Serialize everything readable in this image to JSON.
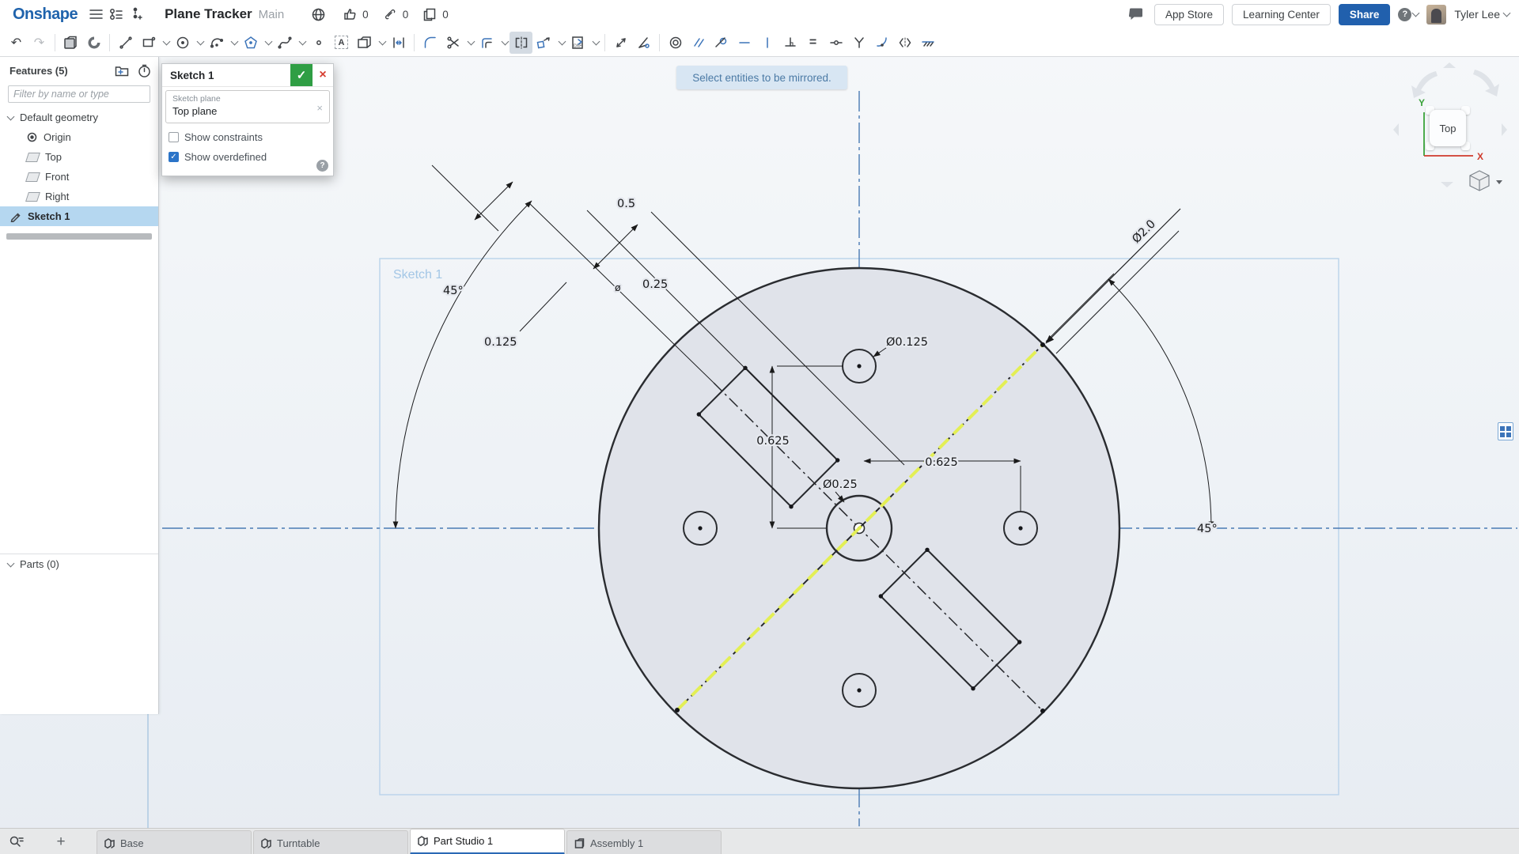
{
  "topbar": {
    "logo": "Onshape",
    "document_title": "Plane Tracker",
    "workspace": "Main",
    "like_count": "0",
    "link_count": "0",
    "copy_count": "0",
    "app_store_label": "App Store",
    "learning_center_label": "Learning Center",
    "share_label": "Share",
    "user_name": "Tyler Lee"
  },
  "glyphs": {
    "check": "✓",
    "close": "×",
    "question": "?",
    "plus": "+",
    "undo": "↶",
    "redo": "↷",
    "equals": "=",
    "letter_a": "A",
    "dxf": "DXF"
  },
  "toast": {
    "message": "Select entities to be mirrored."
  },
  "features_panel": {
    "title": "Features (5)",
    "filter_placeholder": "Filter by name or type",
    "default_geometry_label": "Default geometry",
    "items": [
      {
        "label": "Origin"
      },
      {
        "label": "Top"
      },
      {
        "label": "Front"
      },
      {
        "label": "Right"
      }
    ],
    "sketch_item_label": "Sketch 1",
    "parts_label": "Parts (0)"
  },
  "sketch_dialog": {
    "title": "Sketch 1",
    "plane_field_label": "Sketch plane",
    "plane_field_value": "Top plane",
    "show_constraints_label": "Show constraints",
    "show_overdefined_label": "Show overdefined",
    "show_constraints_checked": false,
    "show_overdefined_checked": true
  },
  "viewcube": {
    "face_label": "Top",
    "x_axis_label": "X",
    "y_axis_label": "Y"
  },
  "canvas": {
    "sketch_region_label": "Sketch 1",
    "dimensions": {
      "angle_left": "45°",
      "angle_right": "45°",
      "len_half": "0.5",
      "len_quarter": "0.25",
      "len_eighth": "0.125",
      "dia_hole_small": "Ø0.125",
      "dia_hole_center": "Ø0.25",
      "dia_outer": "Ø2.0",
      "offset_vertical": "0.625",
      "offset_horizontal": "0.625",
      "stray_dia_symbol": "ø"
    }
  },
  "doc_tabs": {
    "items": [
      {
        "label": "Base",
        "active": false
      },
      {
        "label": "Turntable",
        "active": false
      },
      {
        "label": "Part Studio 1",
        "active": true
      },
      {
        "label": "Assembly 1",
        "active": false
      }
    ]
  },
  "colors": {
    "share_button": "#2160ad",
    "onshape_logo": "#1f63ac",
    "selection_highlight": "#e3ef55",
    "tree_selection": "#b5d7f0",
    "toast_bg": "#d8e6f3",
    "active_tab_underline": "#2a69b5",
    "axis_blue": "#4a7ab3"
  }
}
